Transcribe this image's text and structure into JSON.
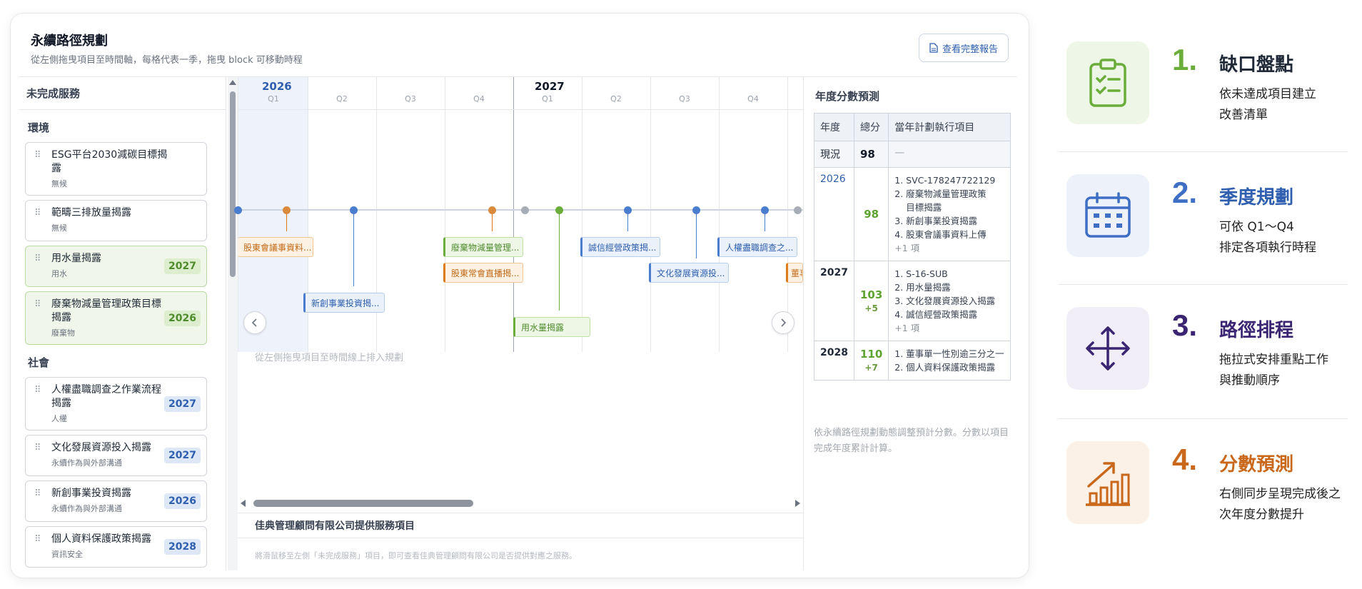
{
  "card": {
    "title": "永續路徑規劃",
    "subtitle": "從左側拖曳項目至時間軸，每格代表一季，拖曳 block 可移動時程",
    "report_button": "查看完整報告"
  },
  "left": {
    "heading": "未完成服務",
    "groups": [
      {
        "title": "環境",
        "items": [
          {
            "name": "ESG平台2030減碳目標揭露",
            "category": "無候",
            "year": "",
            "style": "plain"
          },
          {
            "name": "範疇三排放量揭露",
            "category": "無候",
            "year": "",
            "style": "plain"
          },
          {
            "name": "用水量揭露",
            "category": "用水",
            "year": "2027",
            "style": "green"
          },
          {
            "name": "廢棄物減量管理政策目標揭露",
            "category": "廢棄物",
            "year": "2026",
            "style": "green"
          }
        ]
      },
      {
        "title": "社會",
        "items": [
          {
            "name": "人權盡職調查之作業流程揭露",
            "category": "人權",
            "year": "2027",
            "style": "plain"
          },
          {
            "name": "文化發展資源投入揭露",
            "category": "永續作為與外部溝通",
            "year": "2027",
            "style": "plain"
          },
          {
            "name": "新創事業投資揭露",
            "category": "永續作為與外部溝通",
            "year": "2026",
            "style": "plain"
          },
          {
            "name": "個人資料保護政策揭露",
            "category": "資訊安全",
            "year": "2028",
            "style": "plain"
          }
        ]
      }
    ]
  },
  "timeline": {
    "years": [
      "2026",
      "2027"
    ],
    "quarters": [
      "Q1",
      "Q2",
      "Q3",
      "Q4",
      "Q1",
      "Q2",
      "Q3",
      "Q4"
    ],
    "tags": [
      {
        "label": "股東會議事資料...",
        "color": "o"
      },
      {
        "label": "新創事業投資揭...",
        "color": "b"
      },
      {
        "label": "廢棄物減量管理...",
        "color": "g"
      },
      {
        "label": "股東常會直播揭...",
        "color": "o"
      },
      {
        "label": "用水量揭露",
        "color": "g"
      },
      {
        "label": "誠信經營政策揭...",
        "color": "b"
      },
      {
        "label": "文化發展資源投...",
        "color": "b"
      },
      {
        "label": "人權盡職調查之...",
        "color": "b"
      },
      {
        "label": "董事",
        "color": "o"
      }
    ],
    "drop_hint": "從左側拖曳項目至時間線上排入規劃",
    "provider_title": "佳典管理顧問有限公司提供服務項目",
    "provider_hint": "將滑鼠移至左側「未完成服務」項目，即可查看佳典管理顧問有限公司是否提供對應之服務。",
    "prev_icon": "chevron-left-icon",
    "next_icon": "chevron-right-icon"
  },
  "score": {
    "title": "年度分數預測",
    "headers": [
      "年度",
      "總分",
      "當年計劃執行項目"
    ],
    "current": {
      "label": "現況",
      "score": "98",
      "plan": "—"
    },
    "rows": [
      {
        "year": "2026",
        "score": "98",
        "delta": "",
        "items": [
          "1. SVC-178247722129",
          "2. 廢棄物減量管理政策",
          "目標揭露",
          "3. 新創事業投資揭露",
          "4. 股東會議事資料上傳"
        ],
        "more": "+1 項"
      },
      {
        "year": "2027",
        "score": "103",
        "delta": "+5",
        "items": [
          "1. S-16-SUB",
          "2. 用水量揭露",
          "3. 文化發展資源投入揭露",
          "4. 誠信經營政策揭露"
        ],
        "more": "+1 項"
      },
      {
        "year": "2028",
        "score": "110",
        "delta": "+7",
        "items": [
          "1. 董事單一性別逾三分之一",
          "2. 個人資料保護政策揭露"
        ],
        "more": ""
      }
    ],
    "note": "依永續路徑規劃動態調整預計分數。分數以項目完成年度累計計算。"
  },
  "features": [
    {
      "num": "1.",
      "title": "缺口盤點",
      "desc1": "依未達成項目建立",
      "desc2": "改善清單",
      "color": "#6aad3a",
      "icon": "clipboard-check-icon"
    },
    {
      "num": "2.",
      "title": "季度規劃",
      "desc1": "可依 Q1～Q4",
      "desc2": "排定各項執行時程",
      "color": "#3f6fc4",
      "icon": "calendar-icon"
    },
    {
      "num": "3.",
      "title": "路徑排程",
      "desc1": "拖拉式安排重點工作",
      "desc2": "與推動順序",
      "color": "#3b2573",
      "icon": "move-arrows-icon"
    },
    {
      "num": "4.",
      "title": "分數預測",
      "desc1": "右側同步呈現完成後之",
      "desc2": "次年度分數提升",
      "color": "#c9671a",
      "icon": "growth-chart-icon"
    }
  ]
}
